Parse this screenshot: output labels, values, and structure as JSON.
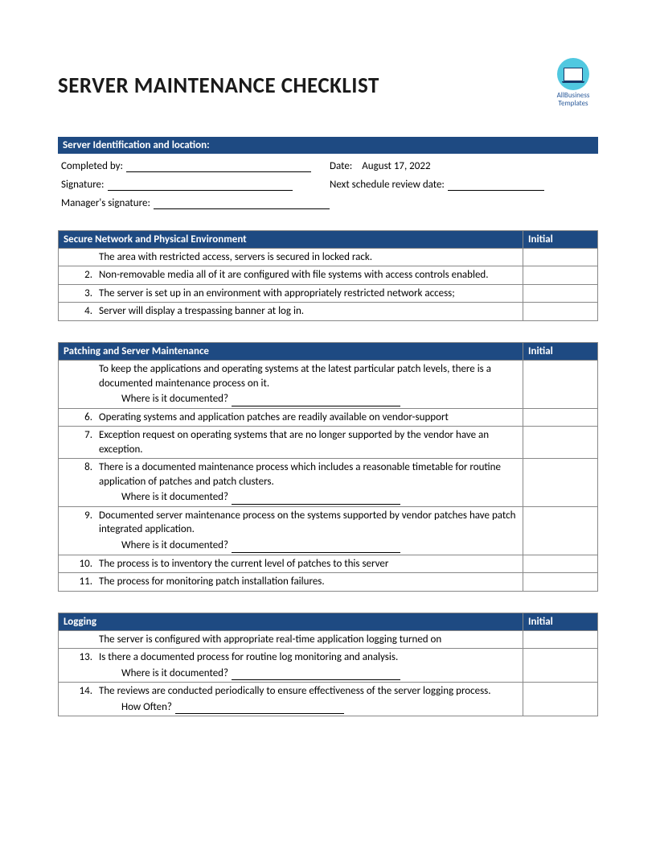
{
  "title": "SERVER MAINTENANCE CHECKLIST",
  "logo": {
    "line1": "AllBusiness",
    "line2": "Templates"
  },
  "ident": {
    "section": "Server Identification and location:",
    "completed_by": "Completed by:",
    "date_label": "Date:",
    "date_value": "August 17, 2022",
    "signature": "Signature:",
    "next_review": "Next schedule review date:",
    "manager_sig": "Manager's signature:"
  },
  "initial_label": "Initial",
  "sections": [
    {
      "title": "Secure Network and Physical Environment",
      "items": [
        {
          "num": "",
          "text": "The area with restricted access, servers is secured in locked rack."
        },
        {
          "num": "2.",
          "text": "Non-removable media all of it are configured with file systems with access controls enabled."
        },
        {
          "num": "3.",
          "text": "The server is set up in an environment with appropriately restricted network access;"
        },
        {
          "num": "4.",
          "text": "Server will display a trespassing banner at log in."
        }
      ]
    },
    {
      "title": "Patching and Server Maintenance",
      "items": [
        {
          "num": "",
          "text": "To keep the applications and operating systems at the latest particular patch levels, there is a documented maintenance process on it.",
          "sub": "Where is it documented?"
        },
        {
          "num": "6.",
          "text": "Operating systems and application patches are readily available on vendor-support"
        },
        {
          "num": "7.",
          "text": "Exception request on operating systems that are no longer supported by the vendor have an exception."
        },
        {
          "num": "8.",
          "text": "There is a documented maintenance process which includes a reasonable timetable for routine application of patches and patch clusters.",
          "sub": "Where is it documented?"
        },
        {
          "num": "9.",
          "text": "Documented server maintenance process on the systems supported by vendor patches have patch integrated application.",
          "sub": "Where is it documented?"
        },
        {
          "num": "10.",
          "text": "The process is to inventory the current level of patches to this server"
        },
        {
          "num": "11.",
          "text": "The process for monitoring patch installation failures."
        }
      ]
    },
    {
      "title": "Logging",
      "items": [
        {
          "num": "",
          "text": "The server is configured with appropriate real-time application logging turned on"
        },
        {
          "num": "13.",
          "text": "Is there a documented process for routine log monitoring and analysis.",
          "sub": "Where is it documented?"
        },
        {
          "num": "14.",
          "text": "The reviews are conducted periodically to ensure effectiveness of the server logging process.",
          "sub": "How Often?"
        }
      ]
    }
  ]
}
